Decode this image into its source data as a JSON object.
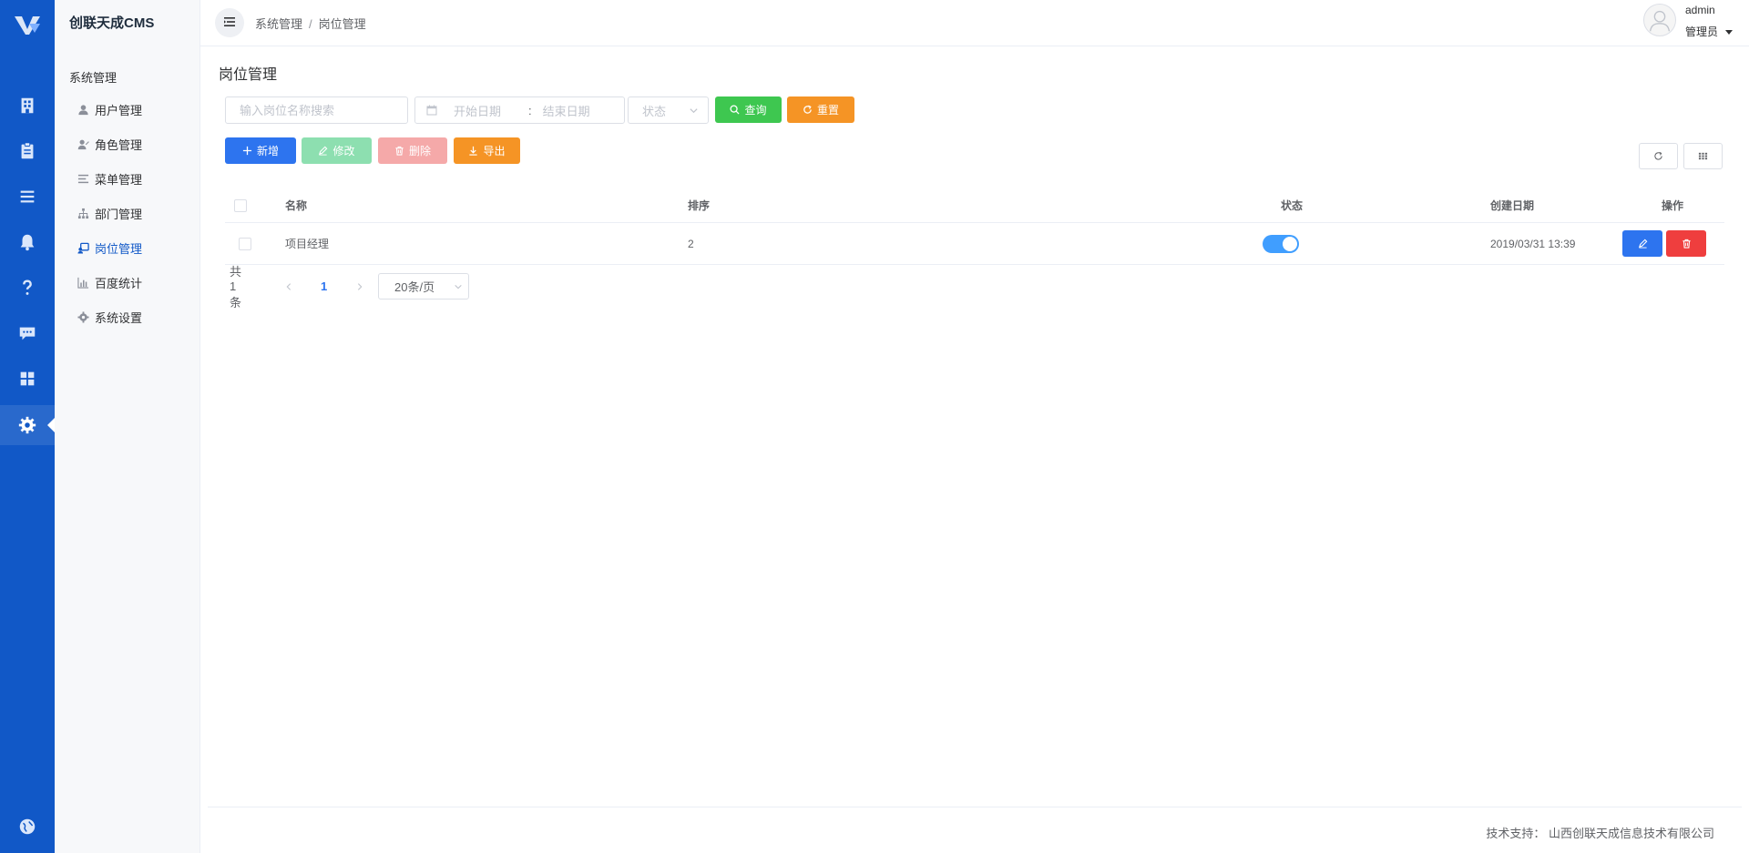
{
  "app": {
    "title": "创联天成CMS"
  },
  "sidebar": {
    "group_label": "系统管理",
    "items": [
      {
        "label": "用户管理",
        "icon": "user-icon"
      },
      {
        "label": "角色管理",
        "icon": "role-icon"
      },
      {
        "label": "菜单管理",
        "icon": "menu-icon"
      },
      {
        "label": "部门管理",
        "icon": "org-chart-icon"
      },
      {
        "label": "岗位管理",
        "icon": "post-icon",
        "active": true
      },
      {
        "label": "百度统计",
        "icon": "bar-chart-icon"
      },
      {
        "label": "系统设置",
        "icon": "gear-icon"
      }
    ]
  },
  "header": {
    "breadcrumb": [
      "系统管理",
      "岗位管理"
    ],
    "breadcrumb_sep": "/",
    "user": {
      "name": "admin",
      "role": "管理员"
    }
  },
  "page": {
    "title": "岗位管理"
  },
  "filters": {
    "name_placeholder": "输入岗位名称搜索",
    "start_date_placeholder": "开始日期",
    "range_sep": ":",
    "end_date_placeholder": "结束日期",
    "status_placeholder": "状态",
    "search_label": "查询",
    "reset_label": "重置"
  },
  "toolbar": {
    "add_label": "新增",
    "edit_label": "修改",
    "delete_label": "删除",
    "export_label": "导出"
  },
  "table": {
    "columns": {
      "name": "名称",
      "sort": "排序",
      "status": "状态",
      "created": "创建日期",
      "actions": "操作"
    },
    "rows": [
      {
        "name": "项目经理",
        "sort": "2",
        "status": true,
        "created": "2019/03/31 13:39"
      }
    ]
  },
  "pagination": {
    "total_text": "共 1 条",
    "current_page": "1",
    "page_size": "20条/页"
  },
  "footer": {
    "text": "技术支持：  山西创联天成信息技术有限公司"
  },
  "colors": {
    "rail_bg": "#1158c7",
    "primary": "#2d74ef",
    "success": "#3ec750",
    "warning": "#f59425",
    "danger": "#ef3e3e",
    "edit_disabled": "#8ddfb0",
    "delete_disabled": "#f5a9a9"
  }
}
